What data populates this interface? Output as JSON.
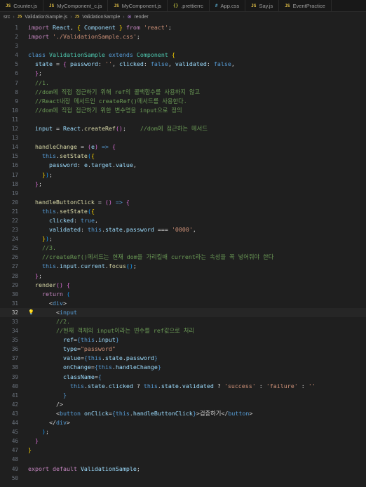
{
  "tabs": [
    {
      "icon": "JS",
      "label": "Counter.js"
    },
    {
      "icon": "JS",
      "label": "MyComponent_c.js"
    },
    {
      "icon": "JS",
      "label": "MyComponent.js"
    },
    {
      "icon": "{}",
      "label": ".prettierrc"
    },
    {
      "icon": "#",
      "label": "App.css"
    },
    {
      "icon": "JS",
      "label": "Say.js"
    },
    {
      "icon": "JS",
      "label": "EventPractice"
    }
  ],
  "breadcrumb": {
    "folder": "src",
    "file_icon": "JS",
    "file": "ValidationSample.js",
    "class_icon": "JS",
    "class": "ValidationSample",
    "method": "render"
  },
  "editor": {
    "current_line": 32,
    "lines": [
      [
        1,
        [
          [
            "kw",
            "import "
          ],
          [
            "var",
            "React"
          ],
          [
            "pl",
            ", "
          ],
          [
            "br1",
            "{ "
          ],
          [
            "var",
            "Component"
          ],
          [
            "br1",
            " }"
          ],
          [
            "kw",
            " from "
          ],
          [
            "str",
            "'react'"
          ],
          [
            "pl",
            ";"
          ]
        ]
      ],
      [
        2,
        [
          [
            "kw",
            "import "
          ],
          [
            "str",
            "'./ValidationSample.css'"
          ],
          [
            "pl",
            ";"
          ]
        ]
      ],
      [
        3,
        []
      ],
      [
        4,
        [
          [
            "st",
            "class "
          ],
          [
            "cls",
            "ValidationSample "
          ],
          [
            "st",
            "extends "
          ],
          [
            "cls",
            "Component "
          ],
          [
            "br1",
            "{"
          ]
        ]
      ],
      [
        5,
        [
          [
            "pl",
            "  "
          ],
          [
            "var",
            "state"
          ],
          [
            "pl",
            " = "
          ],
          [
            "br2",
            "{ "
          ],
          [
            "var",
            "password"
          ],
          [
            "pl",
            ": "
          ],
          [
            "str",
            "''"
          ],
          [
            "pl",
            ", "
          ],
          [
            "var",
            "clicked"
          ],
          [
            "pl",
            ": "
          ],
          [
            "st",
            "false"
          ],
          [
            "pl",
            ", "
          ],
          [
            "var",
            "validated"
          ],
          [
            "pl",
            ": "
          ],
          [
            "st",
            "false"
          ],
          [
            "pl",
            ","
          ]
        ]
      ],
      [
        6,
        [
          [
            "pl",
            "  "
          ],
          [
            "br2",
            "}"
          ],
          [
            "pl",
            ";"
          ]
        ]
      ],
      [
        7,
        [
          [
            "pl",
            "  "
          ],
          [
            "cm",
            "//1."
          ]
        ]
      ],
      [
        8,
        [
          [
            "pl",
            "  "
          ],
          [
            "cm",
            "//dom에 직접 접근하기 위해 ref의 콜백함수를 사용하지 않고"
          ]
        ]
      ],
      [
        9,
        [
          [
            "pl",
            "  "
          ],
          [
            "cm",
            "//React내장 메서드인 createRef()메서드를 사용한다."
          ]
        ]
      ],
      [
        10,
        [
          [
            "pl",
            "  "
          ],
          [
            "cm",
            "//dom에 직접 접근하기 위한 변수명을 input으로 정의"
          ]
        ]
      ],
      [
        11,
        []
      ],
      [
        12,
        [
          [
            "pl",
            "  "
          ],
          [
            "var",
            "input"
          ],
          [
            "pl",
            " = "
          ],
          [
            "var",
            "React"
          ],
          [
            "pl",
            "."
          ],
          [
            "fn",
            "createRef"
          ],
          [
            "br2",
            "()"
          ],
          [
            "pl",
            ";    "
          ],
          [
            "cm",
            "//dom에 접근하는 메서드"
          ]
        ]
      ],
      [
        13,
        []
      ],
      [
        14,
        [
          [
            "pl",
            "  "
          ],
          [
            "fn",
            "handleChange"
          ],
          [
            "pl",
            " = "
          ],
          [
            "br2",
            "("
          ],
          [
            "var",
            "e"
          ],
          [
            "br2",
            ")"
          ],
          [
            "st",
            " => "
          ],
          [
            "br2",
            "{"
          ]
        ]
      ],
      [
        15,
        [
          [
            "pl",
            "    "
          ],
          [
            "st",
            "this"
          ],
          [
            "pl",
            "."
          ],
          [
            "fn",
            "setState"
          ],
          [
            "br3",
            "("
          ],
          [
            "br1",
            "{"
          ]
        ]
      ],
      [
        16,
        [
          [
            "pl",
            "      "
          ],
          [
            "var",
            "password"
          ],
          [
            "pl",
            ": "
          ],
          [
            "var",
            "e"
          ],
          [
            "pl",
            "."
          ],
          [
            "var",
            "target"
          ],
          [
            "pl",
            "."
          ],
          [
            "var",
            "value"
          ],
          [
            "pl",
            ","
          ]
        ]
      ],
      [
        17,
        [
          [
            "pl",
            "    "
          ],
          [
            "br1",
            "}"
          ],
          [
            "br3",
            ")"
          ],
          [
            "pl",
            ";"
          ]
        ]
      ],
      [
        18,
        [
          [
            "pl",
            "  "
          ],
          [
            "br2",
            "}"
          ],
          [
            "pl",
            ";"
          ]
        ]
      ],
      [
        19,
        []
      ],
      [
        20,
        [
          [
            "pl",
            "  "
          ],
          [
            "fn",
            "handleButtonClick"
          ],
          [
            "pl",
            " = "
          ],
          [
            "br2",
            "()"
          ],
          [
            "st",
            " => "
          ],
          [
            "br2",
            "{"
          ]
        ]
      ],
      [
        21,
        [
          [
            "pl",
            "    "
          ],
          [
            "st",
            "this"
          ],
          [
            "pl",
            "."
          ],
          [
            "fn",
            "setState"
          ],
          [
            "br3",
            "("
          ],
          [
            "br1",
            "{"
          ]
        ]
      ],
      [
        22,
        [
          [
            "pl",
            "      "
          ],
          [
            "var",
            "clicked"
          ],
          [
            "pl",
            ": "
          ],
          [
            "st",
            "true"
          ],
          [
            "pl",
            ","
          ]
        ]
      ],
      [
        23,
        [
          [
            "pl",
            "      "
          ],
          [
            "var",
            "validated"
          ],
          [
            "pl",
            ": "
          ],
          [
            "st",
            "this"
          ],
          [
            "pl",
            "."
          ],
          [
            "var",
            "state"
          ],
          [
            "pl",
            "."
          ],
          [
            "var",
            "password"
          ],
          [
            "pl",
            " === "
          ],
          [
            "str",
            "'0000'"
          ],
          [
            "pl",
            ","
          ]
        ]
      ],
      [
        24,
        [
          [
            "pl",
            "    "
          ],
          [
            "br1",
            "}"
          ],
          [
            "br3",
            ")"
          ],
          [
            "pl",
            ";"
          ]
        ]
      ],
      [
        25,
        [
          [
            "pl",
            "    "
          ],
          [
            "cm",
            "//3."
          ]
        ]
      ],
      [
        26,
        [
          [
            "pl",
            "    "
          ],
          [
            "cm",
            "//createRef()메서드는 현재 dom을 가리킬때 current라는 속성을 꼭 넣어줘야 한다"
          ]
        ]
      ],
      [
        27,
        [
          [
            "pl",
            "    "
          ],
          [
            "st",
            "this"
          ],
          [
            "pl",
            "."
          ],
          [
            "var",
            "input"
          ],
          [
            "pl",
            "."
          ],
          [
            "var",
            "current"
          ],
          [
            "pl",
            "."
          ],
          [
            "fn",
            "focus"
          ],
          [
            "br3",
            "()"
          ],
          [
            "pl",
            ";"
          ]
        ]
      ],
      [
        28,
        [
          [
            "pl",
            "  "
          ],
          [
            "br2",
            "}"
          ],
          [
            "pl",
            ";"
          ]
        ]
      ],
      [
        29,
        [
          [
            "pl",
            "  "
          ],
          [
            "fn",
            "render"
          ],
          [
            "br2",
            "()"
          ],
          [
            "pl",
            " "
          ],
          [
            "br2",
            "{"
          ]
        ]
      ],
      [
        30,
        [
          [
            "pl",
            "    "
          ],
          [
            "kw",
            "return"
          ],
          [
            "pl",
            " "
          ],
          [
            "br3",
            "("
          ]
        ]
      ],
      [
        31,
        [
          [
            "pl",
            "      "
          ],
          [
            "pl",
            "<"
          ],
          [
            "tag",
            "div"
          ],
          [
            "pl",
            ">"
          ]
        ]
      ],
      [
        32,
        [
          [
            "pl",
            "        "
          ],
          [
            "pl",
            "<"
          ],
          [
            "tag",
            "input"
          ]
        ]
      ],
      [
        33,
        [
          [
            "pl",
            "        "
          ],
          [
            "cm",
            "//2."
          ]
        ]
      ],
      [
        34,
        [
          [
            "pl",
            "        "
          ],
          [
            "cm",
            "//현재 객체의 input이라는 변수를 ref값으로 처리"
          ]
        ]
      ],
      [
        35,
        [
          [
            "pl",
            "          "
          ],
          [
            "var",
            "ref"
          ],
          [
            "pl",
            "="
          ],
          [
            "st",
            "{"
          ],
          [
            "st",
            "this"
          ],
          [
            "pl",
            "."
          ],
          [
            "var",
            "input"
          ],
          [
            "st",
            "}"
          ]
        ]
      ],
      [
        36,
        [
          [
            "pl",
            "          "
          ],
          [
            "var",
            "type"
          ],
          [
            "pl",
            "="
          ],
          [
            "str",
            "\"password\""
          ]
        ]
      ],
      [
        37,
        [
          [
            "pl",
            "          "
          ],
          [
            "var",
            "value"
          ],
          [
            "pl",
            "="
          ],
          [
            "st",
            "{"
          ],
          [
            "st",
            "this"
          ],
          [
            "pl",
            "."
          ],
          [
            "var",
            "state"
          ],
          [
            "pl",
            "."
          ],
          [
            "var",
            "password"
          ],
          [
            "st",
            "}"
          ]
        ]
      ],
      [
        38,
        [
          [
            "pl",
            "          "
          ],
          [
            "var",
            "onChange"
          ],
          [
            "pl",
            "="
          ],
          [
            "st",
            "{"
          ],
          [
            "st",
            "this"
          ],
          [
            "pl",
            "."
          ],
          [
            "var",
            "handleChange"
          ],
          [
            "st",
            "}"
          ]
        ]
      ],
      [
        39,
        [
          [
            "pl",
            "          "
          ],
          [
            "var",
            "className"
          ],
          [
            "pl",
            "="
          ],
          [
            "st",
            "{"
          ]
        ]
      ],
      [
        40,
        [
          [
            "pl",
            "            "
          ],
          [
            "st",
            "this"
          ],
          [
            "pl",
            "."
          ],
          [
            "var",
            "state"
          ],
          [
            "pl",
            "."
          ],
          [
            "var",
            "clicked"
          ],
          [
            "pl",
            " ? "
          ],
          [
            "st",
            "this"
          ],
          [
            "pl",
            "."
          ],
          [
            "var",
            "state"
          ],
          [
            "pl",
            "."
          ],
          [
            "var",
            "validated"
          ],
          [
            "pl",
            " ? "
          ],
          [
            "str",
            "'success'"
          ],
          [
            "pl",
            " : "
          ],
          [
            "str",
            "'failure'"
          ],
          [
            "pl",
            " : "
          ],
          [
            "str",
            "''"
          ]
        ]
      ],
      [
        41,
        [
          [
            "pl",
            "          "
          ],
          [
            "st",
            "}"
          ]
        ]
      ],
      [
        42,
        [
          [
            "pl",
            "        "
          ],
          [
            "pl",
            "/>"
          ]
        ]
      ],
      [
        43,
        [
          [
            "pl",
            "        "
          ],
          [
            "pl",
            "<"
          ],
          [
            "tag",
            "button"
          ],
          [
            "pl",
            " "
          ],
          [
            "var",
            "onClick"
          ],
          [
            "pl",
            "="
          ],
          [
            "st",
            "{"
          ],
          [
            "st",
            "this"
          ],
          [
            "pl",
            "."
          ],
          [
            "var",
            "handleButtonClick"
          ],
          [
            "st",
            "}"
          ],
          [
            "pl",
            ">검증하기</"
          ],
          [
            "tag",
            "button"
          ],
          [
            "pl",
            ">"
          ]
        ]
      ],
      [
        44,
        [
          [
            "pl",
            "      "
          ],
          [
            "pl",
            "</"
          ],
          [
            "tag",
            "div"
          ],
          [
            "pl",
            ">"
          ]
        ]
      ],
      [
        45,
        [
          [
            "pl",
            "    "
          ],
          [
            "br3",
            ")"
          ],
          [
            "pl",
            ";"
          ]
        ]
      ],
      [
        46,
        [
          [
            "pl",
            "  "
          ],
          [
            "br2",
            "}"
          ]
        ]
      ],
      [
        47,
        [
          [
            "br1",
            "}"
          ]
        ]
      ],
      [
        48,
        []
      ],
      [
        49,
        [
          [
            "kw",
            "export "
          ],
          [
            "kw",
            "default "
          ],
          [
            "var",
            "ValidationSample"
          ],
          [
            "pl",
            ";"
          ]
        ]
      ],
      [
        50,
        []
      ]
    ]
  }
}
